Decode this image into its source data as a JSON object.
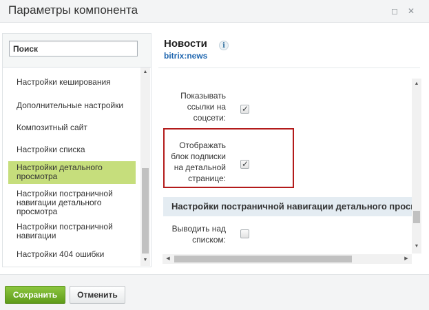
{
  "window": {
    "title": "Параметры компонента",
    "maximize_glyph": "◻",
    "close_glyph": "✕"
  },
  "search": {
    "placeholder": "Поиск",
    "value": ""
  },
  "sidebar": {
    "items": [
      {
        "label": "Настройки кеширования",
        "active": false
      },
      {
        "label": "Дополнительные настройки",
        "active": false
      },
      {
        "label": "Композитный сайт",
        "active": false
      },
      {
        "label": "Настройки списка",
        "active": false
      },
      {
        "label": "Настройки детального просмотра",
        "active": true
      },
      {
        "label": "Настройки постраничной навигации детального просмотра",
        "active": false
      },
      {
        "label": "Настройки постраничной навигации",
        "active": false
      },
      {
        "label": "Настройки 404 ошибки",
        "active": false
      }
    ]
  },
  "component": {
    "name": "Новости",
    "code": "bitrix:news",
    "info_glyph": "i"
  },
  "settings": {
    "show_social_links": {
      "label": "Показывать ссылки на соцсети:",
      "checked": true
    },
    "show_subscribe_block": {
      "label": "Отображать блок подписки на детальной странице:",
      "checked": true
    },
    "section_title": "Настройки постраничной навигации детального просмотра",
    "show_above_list": {
      "label": "Выводить над списком:",
      "checked": false
    }
  },
  "glyphs": {
    "check": "✓",
    "arrow_up": "▲",
    "arrow_down": "▼",
    "arrow_left": "◀",
    "arrow_right": "▶"
  },
  "footer": {
    "save_label": "Сохранить",
    "cancel_label": "Отменить"
  },
  "colors": {
    "active_item_bg": "#c6de7c",
    "save_button": "#6fae2a",
    "highlight_border": "#b31b1b",
    "link_blue": "#2067b0"
  }
}
